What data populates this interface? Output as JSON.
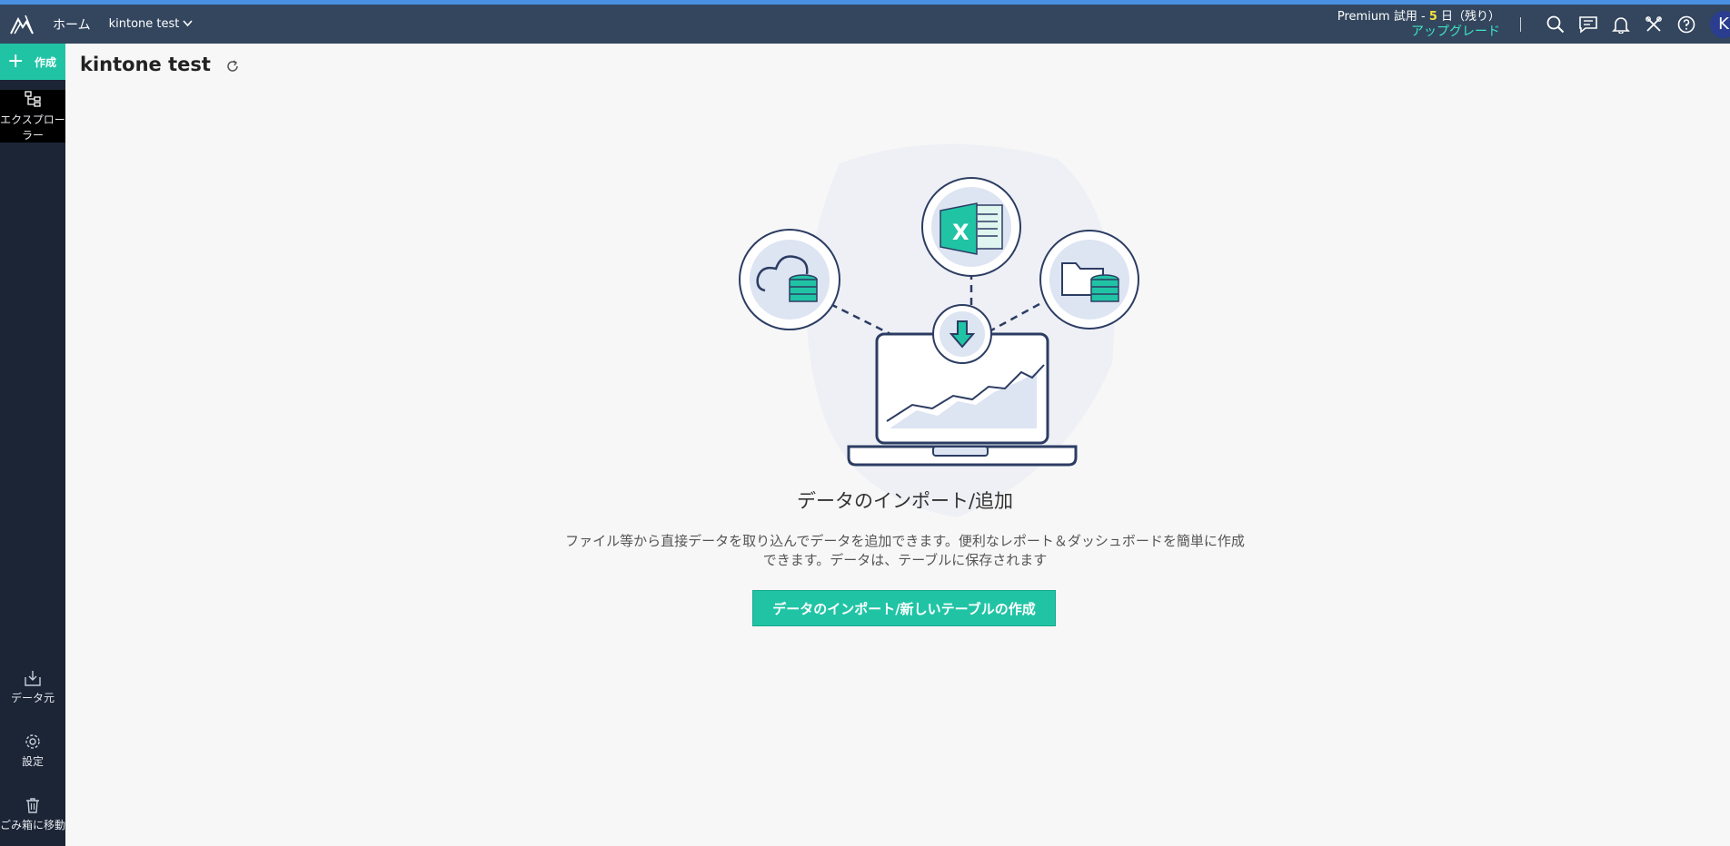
{
  "topbar": {
    "home_label": "ホーム",
    "workspace_label": "kintone test",
    "trial_prefix": "Premium 試用 - ",
    "trial_days": "5",
    "trial_suffix": " 日（残り）",
    "upgrade_label": "アップグレード",
    "avatar_initial": "K",
    "icons": [
      "search-icon",
      "comment-icon",
      "bell-icon",
      "tools-icon",
      "help-icon"
    ]
  },
  "sidebar": {
    "create_label": "作成",
    "explorer_label": "エクスプローラー",
    "bottom_items": [
      {
        "label": "データ元",
        "icon": "import-icon"
      },
      {
        "label": "設定",
        "icon": "gear-icon"
      },
      {
        "label": "ごみ箱に移動",
        "icon": "trash-icon"
      }
    ]
  },
  "main": {
    "title": "kintone test",
    "empty_title": "データのインポート/追加",
    "empty_desc_1": "ファイル等から直接データを取り込んでデータを追加できます。便利なレポート＆ダッシュボードを簡単に作成",
    "empty_desc_2": "できます。データは、テーブルに保存されます",
    "cta_label": "データのインポート/新しいテーブルの作成"
  },
  "colors": {
    "topbar": "#33465e",
    "sidebar": "#1b2536",
    "accent": "#20c4a5",
    "upgrade": "#3fe3c2",
    "trial_days": "#f5e03a"
  }
}
